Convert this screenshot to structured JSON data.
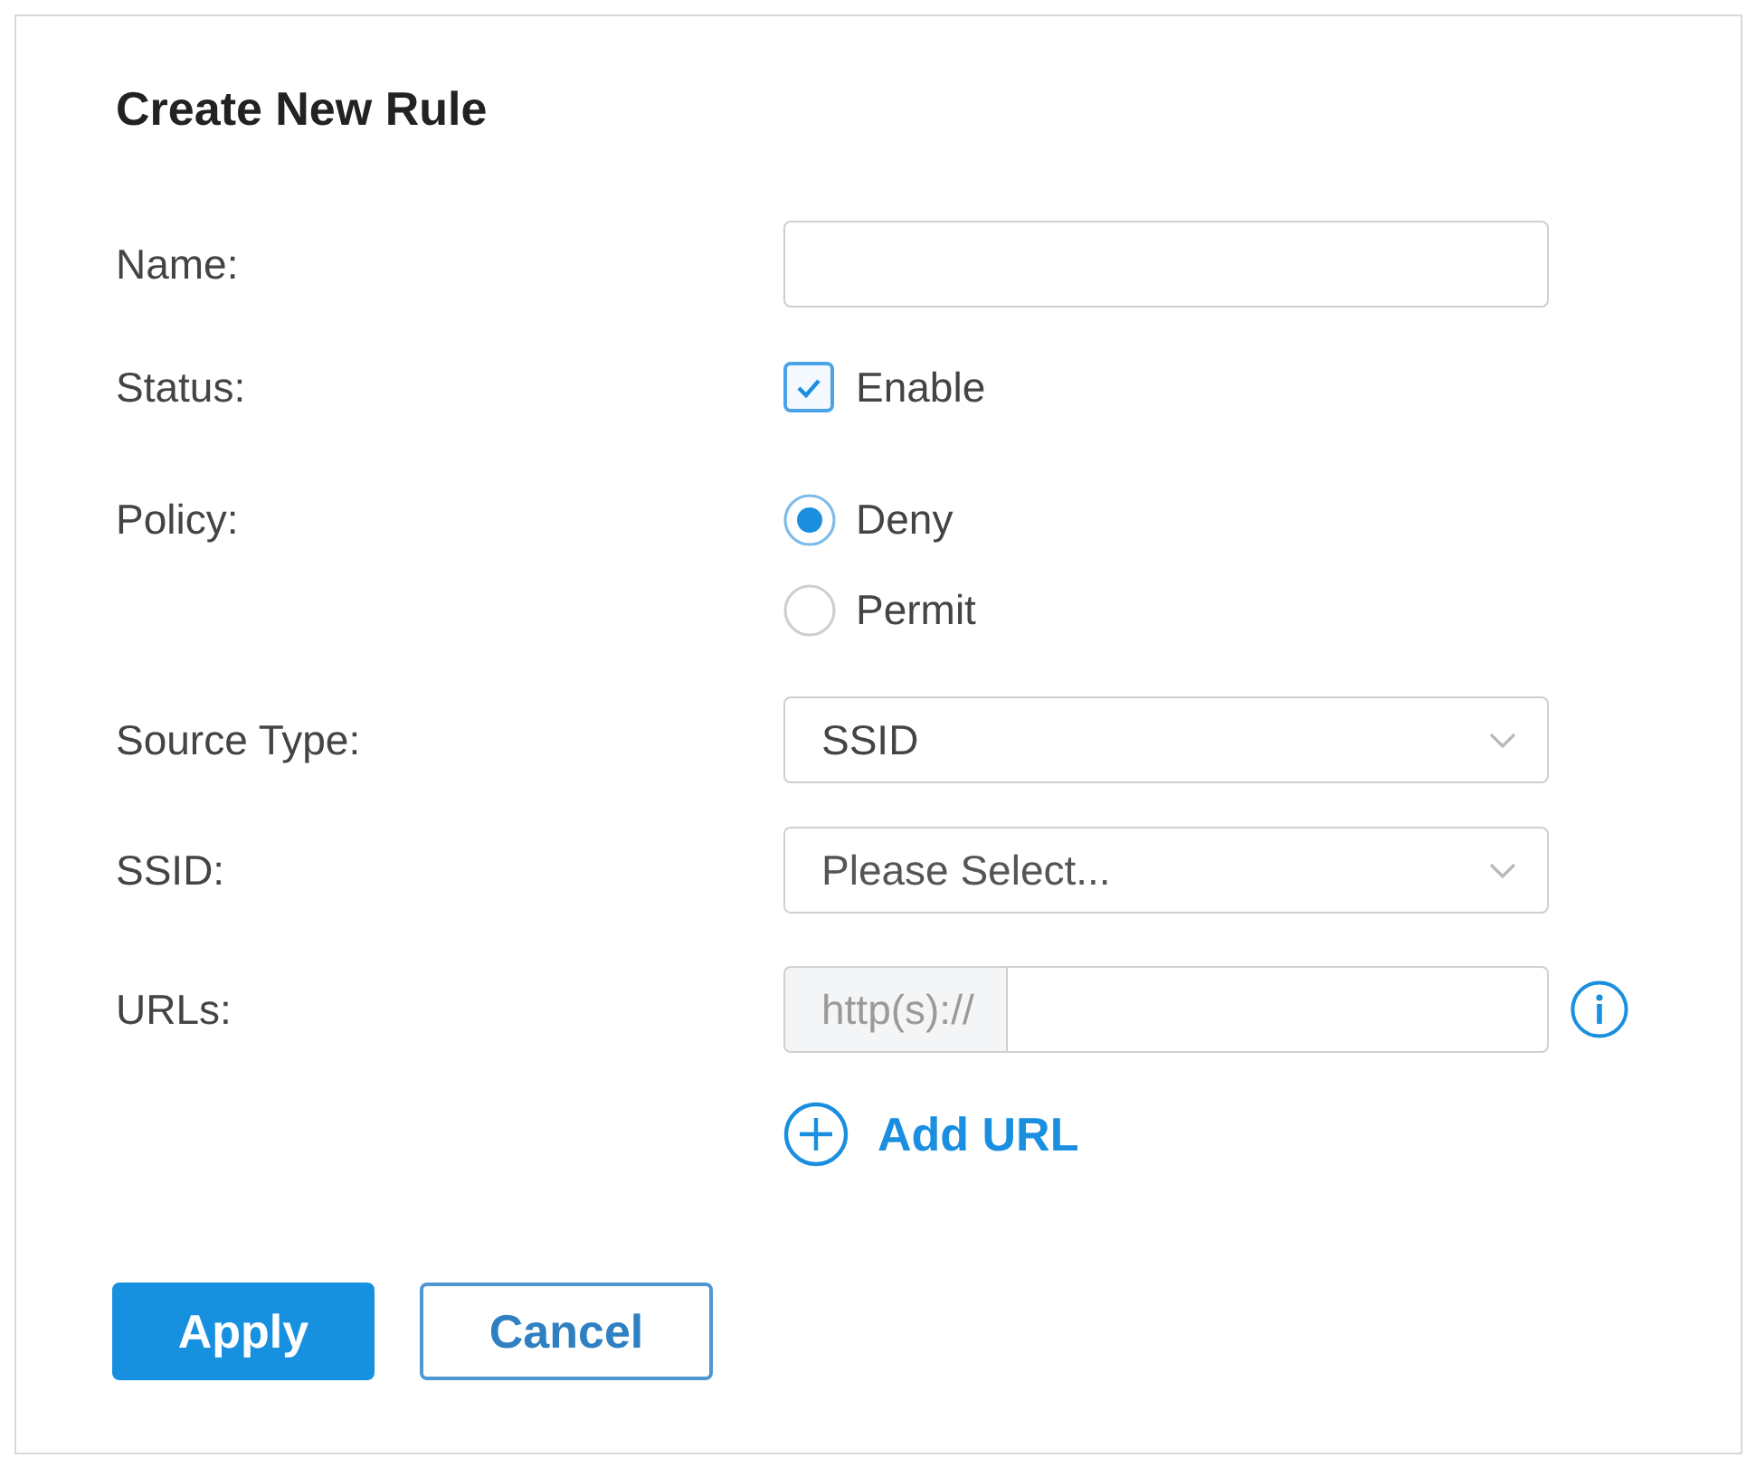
{
  "dialog": {
    "title": "Create New Rule"
  },
  "fields": [
    {
      "kind": "text",
      "label": "Name:"
    },
    {
      "kind": "checkbox",
      "label": "Status:",
      "option": "Enable",
      "checked": true
    },
    {
      "kind": "radio",
      "label": "Policy:",
      "options": [
        {
          "label": "Deny",
          "selected": true
        },
        {
          "label": "Permit",
          "selected": false
        }
      ]
    },
    {
      "kind": "select",
      "label": "Source Type:",
      "value": "SSID"
    },
    {
      "kind": "select",
      "label": "SSID:",
      "placeholder": "Please Select..."
    },
    {
      "kind": "url",
      "label": "URLs:",
      "prefix": "http(s)://",
      "add_label": "Add URL"
    }
  ],
  "buttons": [
    {
      "kind": "primary",
      "label": "Apply"
    },
    {
      "kind": "secondary",
      "label": "Cancel"
    }
  ]
}
